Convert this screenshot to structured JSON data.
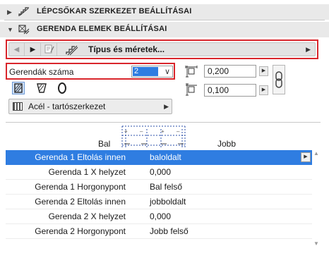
{
  "sections": {
    "stair": {
      "title": "LÉPCSŐKAR SZERKEZET BEÁLLÍTÁSAI",
      "icon": "stair-structure-icon",
      "collapsed": true
    },
    "beam": {
      "title": "GERENDA ELEMEK BEÁLLÍTÁSAI",
      "icon": "beam-elements-icon",
      "collapsed": false
    }
  },
  "nav": {
    "label": "Típus és méretek..."
  },
  "beam_count": {
    "label": "Gerendák száma",
    "value": "2"
  },
  "dimensions": {
    "width": "0,200",
    "height": "0,100"
  },
  "material": {
    "label": "Acél - tartószerkezet"
  },
  "diagram": {
    "left_label": "Bal",
    "right_label": "Jobb"
  },
  "rows": [
    {
      "name": "Gerenda 1 Eltolás innen",
      "value": "baloldalt",
      "selected": true
    },
    {
      "name": "Gerenda 1 X helyzet",
      "value": "0,000"
    },
    {
      "name": "Gerenda 1 Horgonypont",
      "value": "Bal felső"
    },
    {
      "name": "Gerenda 2 Eltolás innen",
      "value": "jobboldalt"
    },
    {
      "name": "Gerenda 2 X helyzet",
      "value": "0,000"
    },
    {
      "name": "Gerenda 2 Horgonypont",
      "value": "Jobb felső"
    }
  ],
  "colors": {
    "selection": "#2f7de1",
    "highlight_box": "#d9262c",
    "header_bg": "#e9e9e9"
  }
}
